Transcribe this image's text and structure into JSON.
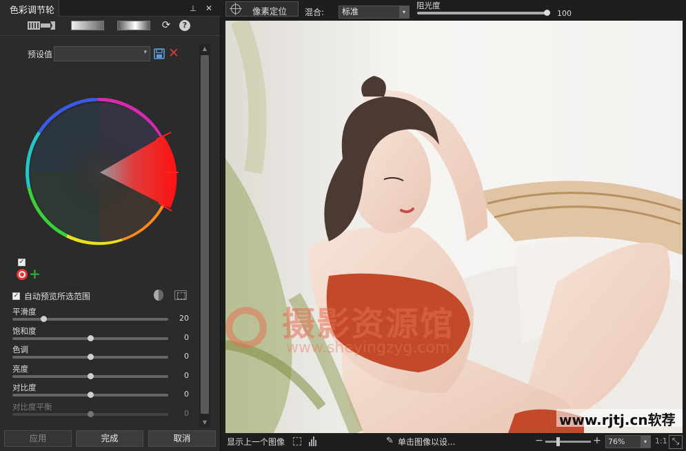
{
  "panel": {
    "tab_title": "色彩调节轮",
    "pin_glyph": "⊥",
    "close_glyph": "✕",
    "toolbar": {
      "refresh_icon": "refresh-icon",
      "help_glyph": "?"
    },
    "preset": {
      "label": "预设值",
      "value": "",
      "arrow": "▾",
      "delete_glyph": "✕"
    },
    "checkbox_glyph": "✓",
    "add_glyph": "+",
    "auto_preview_label": "自动预览所选范围",
    "sliders": [
      {
        "label": "平滑度",
        "value": "20",
        "fraction": 0.2,
        "enabled": true
      },
      {
        "label": "饱和度",
        "value": "0",
        "fraction": 0.5,
        "enabled": true
      },
      {
        "label": "色调",
        "value": "0",
        "fraction": 0.5,
        "enabled": true
      },
      {
        "label": "亮度",
        "value": "0",
        "fraction": 0.5,
        "enabled": true
      },
      {
        "label": "对比度",
        "value": "0",
        "fraction": 0.5,
        "enabled": true
      },
      {
        "label": "对比度平衡",
        "value": "0",
        "fraction": 0.5,
        "enabled": false
      }
    ],
    "scroll_up": "▲",
    "scroll_down": "▼",
    "buttons": {
      "apply": "应用",
      "done": "完成",
      "cancel": "取消"
    }
  },
  "topbar": {
    "pixel_locate": "像素定位",
    "blend_label": "混合:",
    "blend_value": "标准",
    "arrow": "▾",
    "opacity_label": "阻光度",
    "opacity_value": "100",
    "opacity_fraction": 1.0
  },
  "image": {
    "watermark_cn": "摄影资源馆",
    "watermark_url": "www.sheyingzyg.com",
    "site_mark": "www.rjtj.cn软荐网"
  },
  "statusbar": {
    "show_prev": "显示上一个图像",
    "dropper_glyph": "✎",
    "click_hint": "单击图像以设...",
    "zoom_minus": "−",
    "zoom_plus": "+",
    "zoom_value": "76%",
    "arrow": "▾",
    "one_to_one": "1:1",
    "expand_glyph": "⤡"
  },
  "colors": {
    "accent_red": "#e33333",
    "add_green": "#2ea635",
    "panel_bg": "#2b2b2b"
  }
}
